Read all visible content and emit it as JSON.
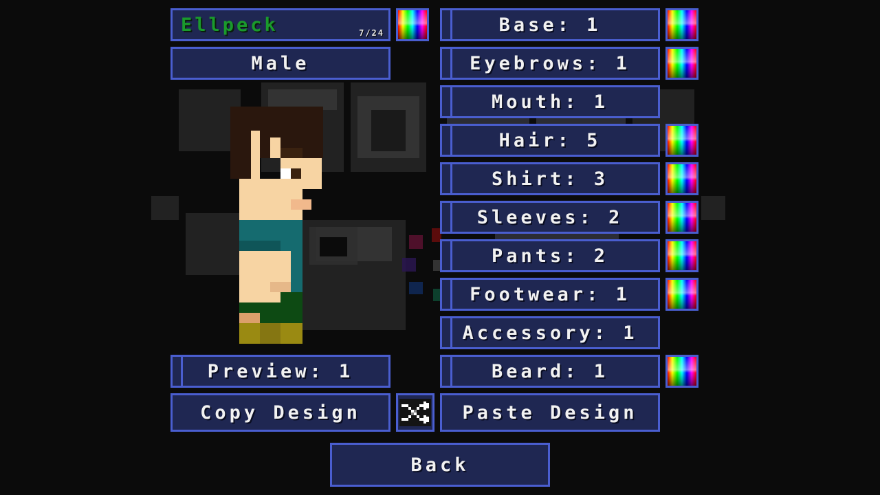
{
  "character": {
    "name": "Ellpeck",
    "name_length": "7/24",
    "gender": "Male"
  },
  "options": [
    {
      "key": "base",
      "label": "Base: 1",
      "color": true
    },
    {
      "key": "eyebrows",
      "label": "Eyebrows: 1",
      "color": true
    },
    {
      "key": "mouth",
      "label": "Mouth: 1",
      "color": false
    },
    {
      "key": "hair",
      "label": "Hair: 5",
      "color": true
    },
    {
      "key": "shirt",
      "label": "Shirt: 3",
      "color": true
    },
    {
      "key": "sleeves",
      "label": "Sleeves: 2",
      "color": true
    },
    {
      "key": "pants",
      "label": "Pants: 2",
      "color": true
    },
    {
      "key": "footwear",
      "label": "Footwear: 1",
      "color": true
    },
    {
      "key": "accessory",
      "label": "Accessory: 1",
      "color": false
    },
    {
      "key": "beard",
      "label": "Beard: 1",
      "color": true
    }
  ],
  "preview_label": "Preview: 1",
  "copy_label": "Copy Design",
  "paste_label": "Paste Design",
  "back_label": "Back",
  "icons": {
    "color_swatch": "rainbow-gradient",
    "shuffle": "shuffle-icon"
  },
  "colors": {
    "panel_bg": "#1f2752",
    "panel_border": "#4a5ed0",
    "name_text": "#1a9a2c",
    "background": "#0b0b0b"
  }
}
